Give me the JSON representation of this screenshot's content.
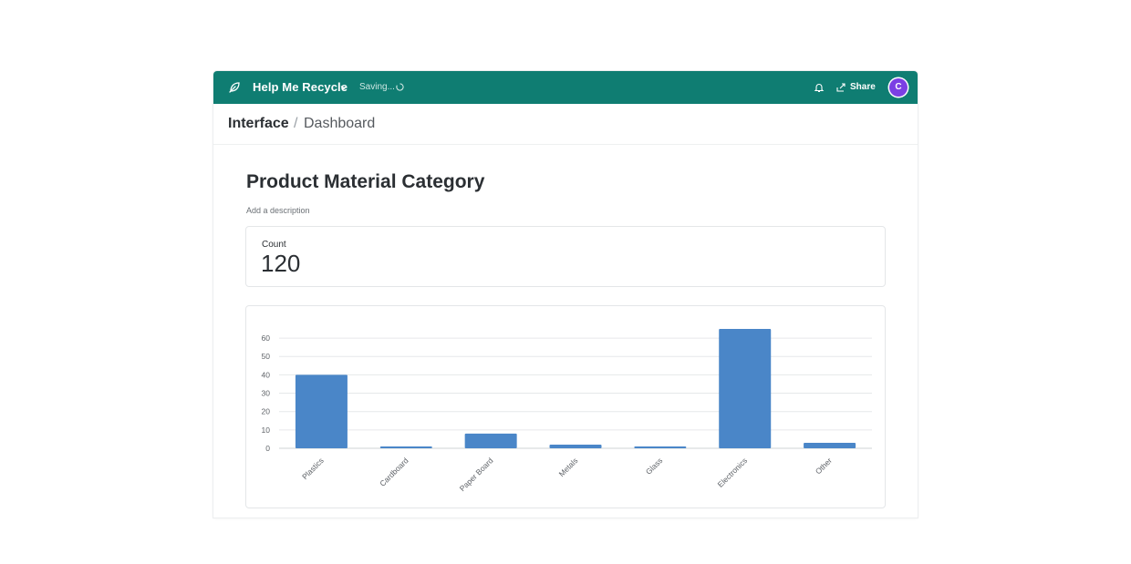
{
  "topbar": {
    "app_name": "Help Me Recycle",
    "saving_text": "Saving...",
    "share_label": "Share",
    "avatar_initial": "C",
    "background_color": "#0f7d72",
    "avatar_color": "#7b3fe4",
    "icons": [
      "leaf-icon",
      "chevron-down-icon",
      "spinner-icon",
      "bell-icon",
      "share-icon"
    ]
  },
  "breadcrumb": {
    "parent": "Interface",
    "separator": "/",
    "current": "Dashboard"
  },
  "page": {
    "title": "Product Material Category",
    "description_placeholder": "Add a description"
  },
  "count_card": {
    "label": "Count",
    "value": "120"
  },
  "chart_data": {
    "type": "bar",
    "categories": [
      "Plastics",
      "Cardboard",
      "Paper Board",
      "Metals",
      "Glass",
      "Electronics",
      "Other"
    ],
    "values": [
      40,
      1,
      8,
      2,
      1,
      65,
      3
    ],
    "yticks": [
      0,
      10,
      20,
      30,
      40,
      50,
      60
    ],
    "ylim": [
      0,
      65
    ],
    "grid": true,
    "bar_color": "#4a86c8"
  }
}
